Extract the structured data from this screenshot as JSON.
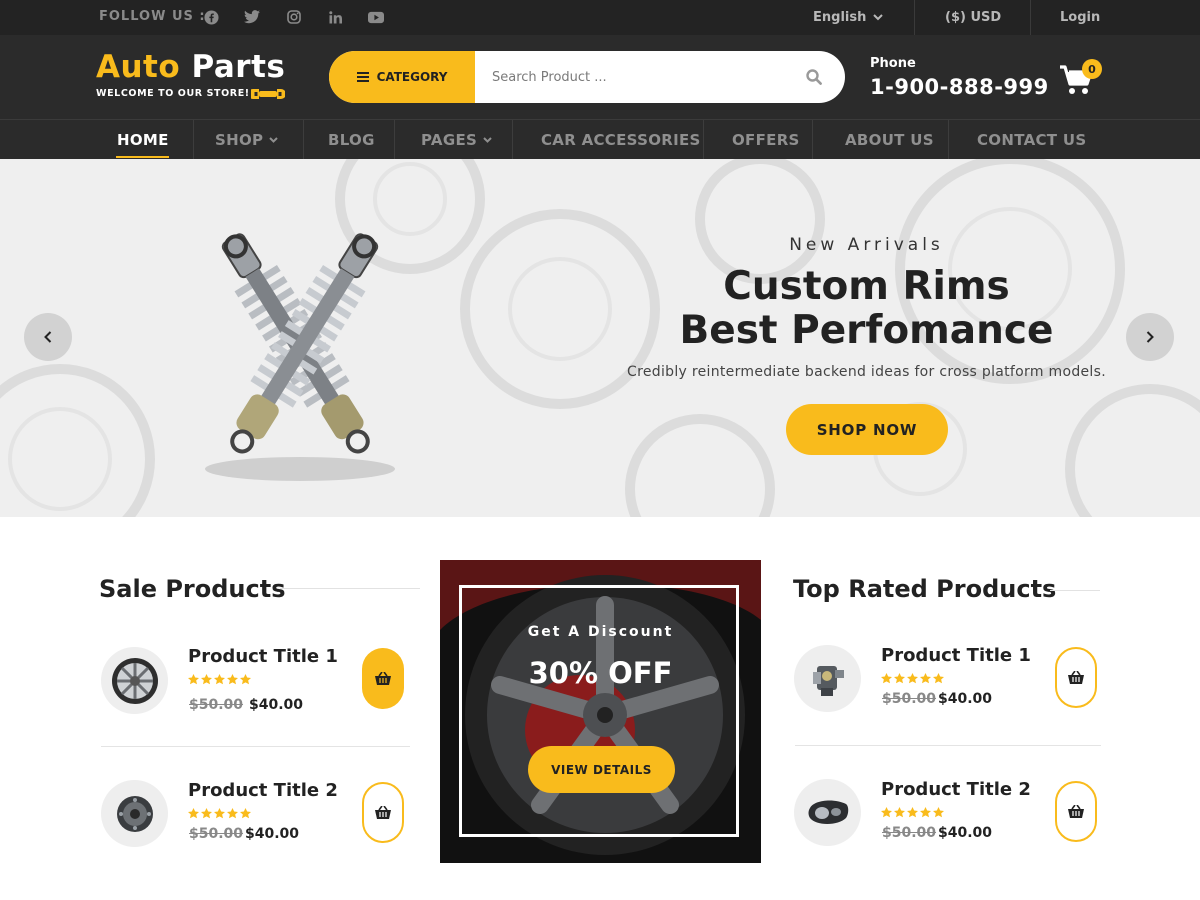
{
  "topbar": {
    "follow_label": "FOLLOW US :",
    "social_icons": [
      "facebook-icon",
      "twitter-icon",
      "instagram-icon",
      "linkedin-icon",
      "youtube-icon"
    ],
    "language": "English",
    "currency": "($) USD",
    "login": "Login"
  },
  "header": {
    "logo_part1": "Auto",
    "logo_part2": "Parts",
    "logo_tagline": "WELCOME TO OUR STORE!",
    "category_label": "CATEGORY",
    "search_placeholder": "Search Product ...",
    "phone_label": "Phone",
    "phone_number": "1-900-888-999",
    "cart_count": "0"
  },
  "nav": {
    "items": [
      {
        "label": "HOME"
      },
      {
        "label": "SHOP"
      },
      {
        "label": "BLOG"
      },
      {
        "label": "PAGES"
      },
      {
        "label": "CAR ACCESSORIES"
      },
      {
        "label": "OFFERS"
      },
      {
        "label": "ABOUT US"
      },
      {
        "label": "CONTACT US"
      }
    ]
  },
  "hero": {
    "subtitle": "New Arrivals",
    "title_line1": "Custom Rims",
    "title_line2": "Best Perfomance",
    "description": "Credibly reintermediate backend ideas for cross platform models.",
    "button": "SHOP NOW"
  },
  "sale_products": {
    "title": "Sale Products",
    "items": [
      {
        "title": "Product Title 1",
        "old_price": "$50.00",
        "new_price": "$40.00",
        "rating": 5
      },
      {
        "title": "Product Title 2",
        "old_price": "$50.00",
        "new_price": "$40.00",
        "rating": 5
      }
    ]
  },
  "promo": {
    "subtitle": "Get A Discount",
    "headline": "30% OFF",
    "button": "VIEW DETAILS"
  },
  "top_rated": {
    "title": "Top Rated Products",
    "items": [
      {
        "title": "Product Title 1",
        "old_price": "$50.00",
        "new_price": "$40.00",
        "rating": 5
      },
      {
        "title": "Product Title 2",
        "old_price": "$50.00",
        "new_price": "$40.00",
        "rating": 5
      }
    ]
  },
  "colors": {
    "accent": "#f9bb1c",
    "dark": "#2b2b2b",
    "topbar": "#232323"
  }
}
